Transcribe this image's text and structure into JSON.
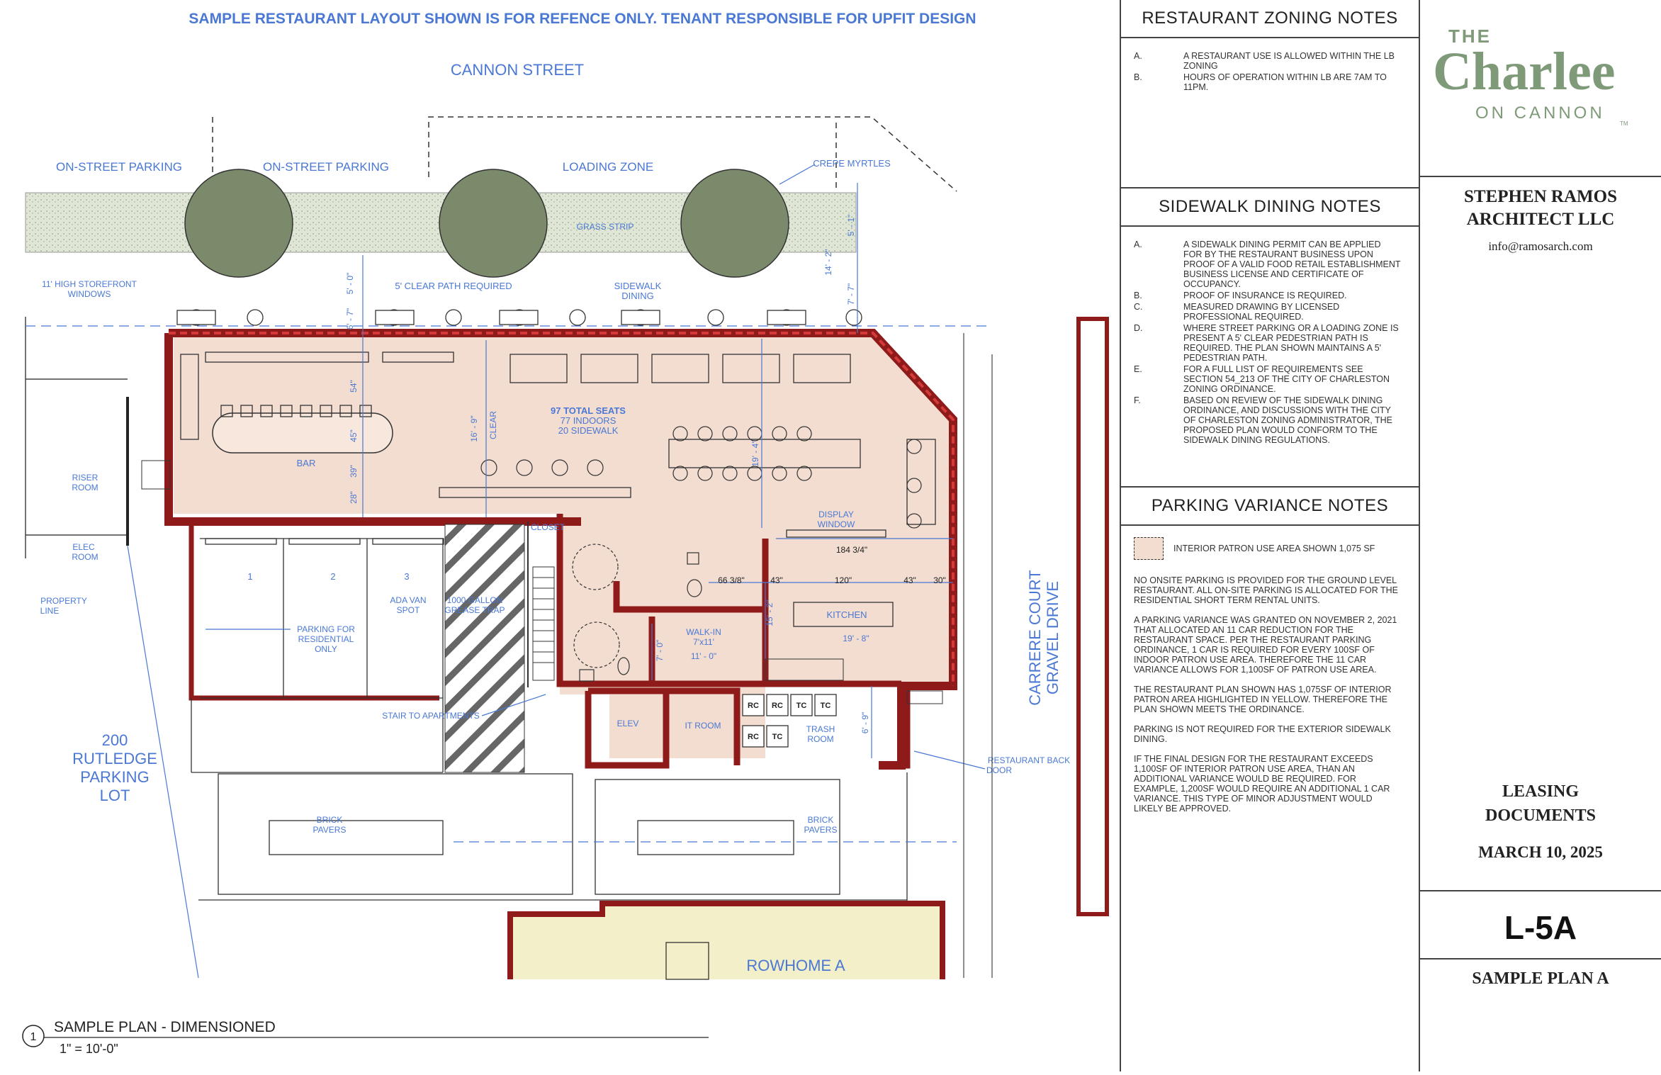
{
  "plan": {
    "header_note": "SAMPLE RESTAURANT LAYOUT SHOWN IS FOR REFENCE ONLY.  TENANT RESPONSIBLE FOR UPFIT DESIGN",
    "street": "CANNON STREET",
    "on_street_parking_1": "ON-STREET PARKING",
    "on_street_parking_2": "ON-STREET PARKING",
    "loading_zone": "LOADING ZONE",
    "crepe_myrtles": "CREPE MYRTLES",
    "grass_strip": "GRASS STRIP",
    "storefront_windows_1": "11' HIGH STOREFRONT",
    "storefront_windows_2": "WINDOWS",
    "clear_path": "5' CLEAR PATH REQUIRED",
    "sidewalk_dining_1": "SIDEWALK",
    "sidewalk_dining_2": "DINING",
    "seats_total": "97 TOTAL SEATS",
    "seats_indoors": "77 INDOORS",
    "seats_sidewalk": "20 SIDEWALK",
    "bar": "BAR",
    "clear": "CLEAR",
    "riser_room_1": "RISER",
    "riser_room_2": "ROOM",
    "elec_room_1": "ELEC",
    "elec_room_2": "ROOM",
    "property_line_1": "PROPERTY",
    "property_line_2": "LINE",
    "space_1": "1",
    "space_2": "2",
    "space_3": "3",
    "ada_1": "ADA VAN",
    "ada_2": "SPOT",
    "parking_res_1": "PARKING FOR",
    "parking_res_2": "RESIDENTIAL",
    "parking_res_3": "ONLY",
    "grease_1": "1000 GALLON",
    "grease_2": "GREASE TRAP",
    "closet": "CLOSET",
    "display_window_1": "DISPLAY",
    "display_window_2": "WINDOW",
    "kitchen": "KITCHEN",
    "walkin_1": "WALK-IN",
    "walkin_2": "7'x11'",
    "walkin_3": "11' - 0\"",
    "elev": "ELEV",
    "it_room": "IT ROOM",
    "trash_1": "TRASH",
    "trash_2": "ROOM",
    "stair": "STAIR TO APARTMENTS",
    "back_door_1": "RESTAURANT BACK",
    "back_door_2": "DOOR",
    "rutledge_1": "200",
    "rutledge_2": "RUTLEDGE",
    "rutledge_3": "PARKING",
    "rutledge_4": "LOT",
    "brick_pavers_1a": "BRICK",
    "brick_pavers_1b": "PAVERS",
    "brick_pavers_2a": "BRICK",
    "brick_pavers_2b": "PAVERS",
    "carrere_1": "CARRERE COURT",
    "carrere_2": "GRAVEL DRIVE",
    "rowhome": "ROWHOME A",
    "bins": [
      "RC",
      "RC",
      "TC",
      "TC",
      "RC",
      "TC"
    ],
    "dims": {
      "d_5_0": "5' - 0\"",
      "d_6_7": "6' - 7\"",
      "d_54": "54\"",
      "d_45": "45\"",
      "d_39": "39\"",
      "d_28": "28\"",
      "d_16_9": "16' - 9\"",
      "d_19_4": "19' - 4\"",
      "d_14_2": "14' - 2\"",
      "d_7_7": "7' - 7\"",
      "d_5_1": "5' - 1\"",
      "d_184": "184 3/4\"",
      "d_66": "66 3/8\"",
      "d_43a": "43\"",
      "d_120": "120\"",
      "d_43b": "43\"",
      "d_30": "30\"",
      "d_15_2": "15' - 2\"",
      "d_19_8": "19' - 8\"",
      "d_7_0": "7' - 0\"",
      "d_6_9": "6' - 9\""
    },
    "title_number": "1",
    "title_name": "SAMPLE PLAN - DIMENSIONED",
    "scale": "1\" = 10'-0\""
  },
  "notes": {
    "zoning": {
      "heading": "RESTAURANT ZONING NOTES",
      "items": [
        {
          "letter": "A.",
          "text": "A RESTAURANT USE IS ALLOWED WITHIN THE LB ZONING"
        },
        {
          "letter": "B.",
          "text": "HOURS OF OPERATION WITHIN LB ARE 7AM TO 11PM."
        }
      ]
    },
    "sidewalk": {
      "heading": "SIDEWALK DINING NOTES",
      "items": [
        {
          "letter": "A.",
          "text": "A SIDEWALK DINING PERMIT CAN BE APPLIED FOR BY THE RESTAURANT BUSINESS UPON PROOF OF A VALID FOOD RETAIL ESTABLISHMENT BUSINESS LICENSE AND CERTIFICATE OF OCCUPANCY."
        },
        {
          "letter": "B.",
          "text": "PROOF OF INSURANCE IS REQUIRED."
        },
        {
          "letter": "C.",
          "text": "MEASURED DRAWING BY LICENSED PROFESSIONAL REQUIRED."
        },
        {
          "letter": "D.",
          "text": "WHERE STREET PARKING OR A LOADING ZONE IS PRESENT A 5' CLEAR PEDESTRIAN PATH IS REQUIRED.  THE PLAN SHOWN MAINTAINS A 5' PEDESTRIAN PATH."
        },
        {
          "letter": "E.",
          "text": "FOR A FULL LIST OF REQUIREMENTS SEE SECTION 54_213 OF THE CITY OF CHARLESTON ZONING ORDINANCE."
        },
        {
          "letter": "F.",
          "text": "BASED ON REVIEW OF THE SIDEWALK DINING ORDINANCE, AND DISCUSSIONS WITH THE CITY OF CHARLESTON ZONING ADMINISTRATOR, THE PROPOSED PLAN WOULD CONFORM TO THE SIDEWALK DINING REGULATIONS."
        }
      ]
    },
    "parking": {
      "heading": "PARKING VARIANCE NOTES",
      "legend": "INTERIOR PATRON USE AREA SHOWN  1,075 SF",
      "paragraphs": [
        "NO ONSITE PARKING IS PROVIDED FOR THE GROUND LEVEL RESTAURANT.  ALL ON-SITE PARKING IS ALLOCATED FOR THE RESIDENTIAL SHORT TERM RENTAL UNITS.",
        "A PARKING VARIANCE WAS GRANTED ON NOVEMBER 2, 2021 THAT ALLOCATED AN 11 CAR REDUCTION FOR THE RESTAURANT SPACE.  PER THE RESTAURANT PARKING ORDINANCE, 1 CAR IS REQUIRED FOR EVERY 100SF OF INDOOR PATRON USE AREA.  THEREFORE THE 11 CAR VARIANCE ALLOWS FOR 1,100SF OF PATRON USE AREA.",
        "THE RESTAURANT PLAN SHOWN HAS 1,075SF OF INTERIOR PATRON AREA HIGHLIGHTED IN YELLOW.  THEREFORE THE PLAN SHOWN MEETS THE ORDINANCE.",
        "PARKING IS NOT REQUIRED FOR THE EXTERIOR SIDEWALK DINING.",
        "IF THE FINAL DESIGN FOR THE RESTAURANT EXCEEDS 1,100SF OF INTERIOR PATRON USE AREA, THAN AN ADDITIONAL VARIANCE WOULD BE REQUIRED.  FOR EXAMPLE, 1,200SF WOULD REQUIRE AN ADDITIONAL 1 CAR VARIANCE.  THIS TYPE OF MINOR ADJUSTMENT WOULD LIKELY BE APPROVED."
      ]
    }
  },
  "title_block": {
    "logo_the": "THE",
    "logo_name": "Charlee",
    "logo_on": "ON CANNON",
    "logo_tm": "TM",
    "firm_1": "STEPHEN RAMOS",
    "firm_2": "ARCHITECT LLC",
    "email": "info@ramosarch.com",
    "doc_1": "LEASING",
    "doc_2": "DOCUMENTS",
    "date": "MARCH 10, 2025",
    "sheet_no": "L-5A",
    "sheet_name": "SAMPLE PLAN A"
  },
  "colors": {
    "blue": "#4a78d4",
    "wall": "#8f1a1a",
    "wall_hatch": "#d33a3a",
    "interior": "#f2ddd0",
    "tree": "#7a8a6a",
    "grass": "#d9e2cf",
    "rowhome": "#f3efc8",
    "logo": "#7f9a79"
  }
}
